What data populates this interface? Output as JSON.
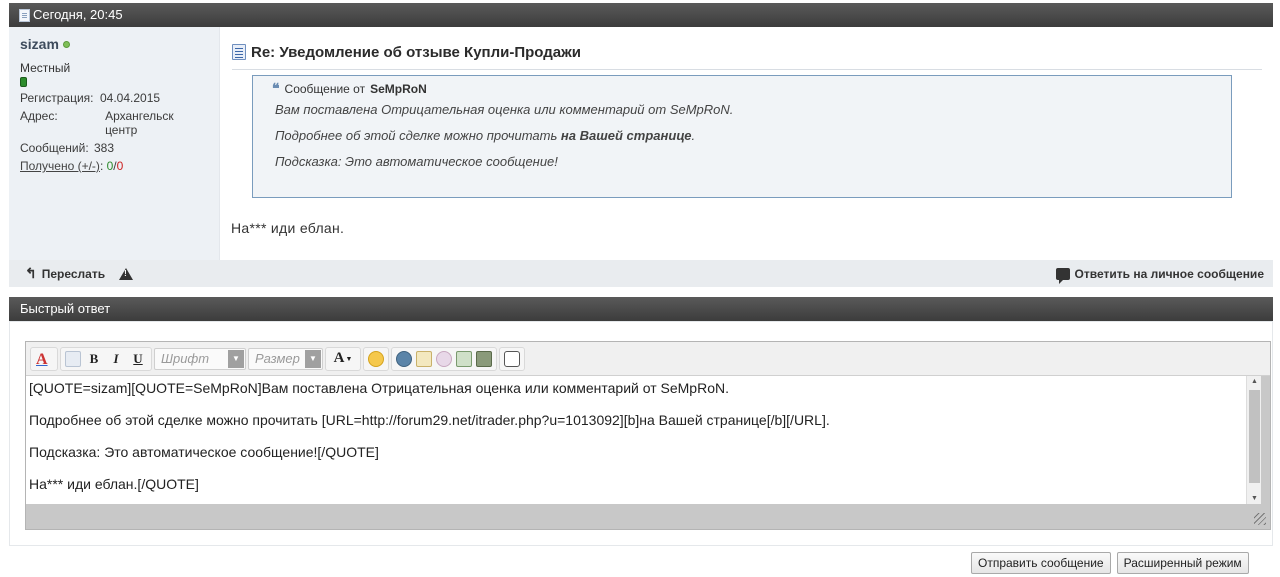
{
  "post": {
    "date": "Сегодня, 20:45",
    "title": "Re: Уведомление об отзыве Купли-Продажи",
    "message": "На*** иди еблан."
  },
  "user": {
    "name": "sizam",
    "title": "Местный",
    "registration_label": "Регистрация:",
    "registration_value": "04.04.2015",
    "address_label": "Адрес:",
    "address_value": "Архангельск центр",
    "posts_label": "Сообщений:",
    "posts_value": "383",
    "reputation_label": "Получено (+/-)",
    "reputation_colon": ": ",
    "reputation_pos": "0",
    "reputation_sep": "/",
    "reputation_neg": "0",
    "online_color": "#7fbf58"
  },
  "quote": {
    "prefix": "Сообщение от",
    "author": "SeMpRoN",
    "line1": "Вам поставлена Отрицательная оценка или комментарий от SeMpRoN.",
    "line2_text": "Подробнее об этой сделке можно прочитать ",
    "line2_bold": "на Вашей странице",
    "line2_end": ".",
    "line3": "Подсказка: Это автоматическое сообщение!"
  },
  "footer": {
    "forward_label": "Переслать",
    "reply_pm_label": "Ответить на личное сообщение"
  },
  "quick_reply": {
    "header": "Быстрый ответ",
    "font_placeholder": "Шрифт",
    "size_placeholder": "Размер",
    "text_lines": [
      "[QUOTE=sizam][QUOTE=SeMpRoN]Вам поставлена Отрицательная оценка или комментарий от SeMpRoN.",
      "Подробнее об этой сделке можно прочитать [URL=http://forum29.net/itrader.php?u=1013092][b]на Вашей странице[/b][/URL].",
      "Подсказка: Это автоматическое сообщение![/QUOTE]",
      "На*** иди еблан.[/QUOTE]"
    ],
    "submit_label": "Отправить сообщение",
    "advanced_label": "Расширенный режим"
  },
  "colors": {
    "header_bg": "#4a4a4a",
    "quote_border": "#7a9cbd",
    "negative": "#cc2222",
    "positive": "#2d8a2d"
  }
}
